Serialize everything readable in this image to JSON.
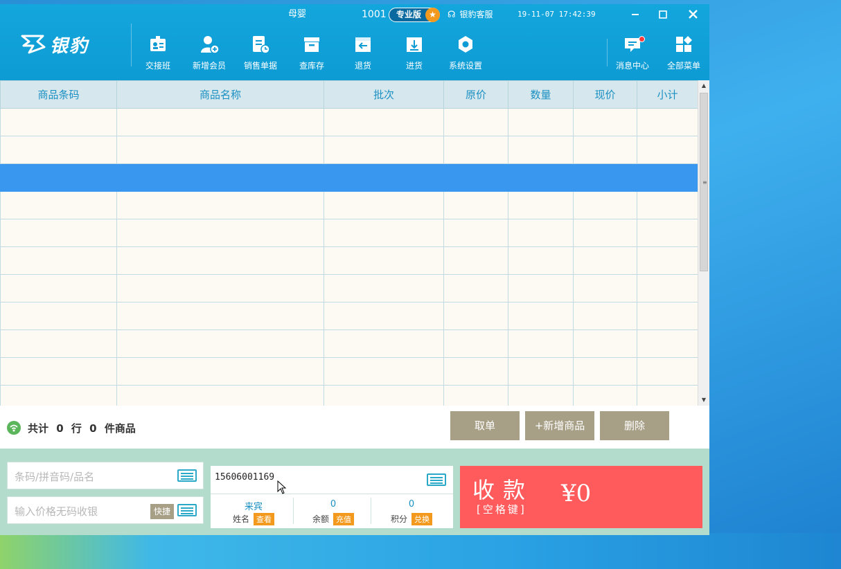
{
  "header": {
    "store_name": "母婴",
    "account_no": "1001",
    "edition": "专业版",
    "service_label": "银豹客服",
    "datetime": "19-11-07 17:42:39",
    "logo_text": "银豹",
    "nav": [
      {
        "label": "交接班",
        "icon": "handover-icon"
      },
      {
        "label": "新增会员",
        "icon": "add-member-icon"
      },
      {
        "label": "销售单据",
        "icon": "sales-doc-icon"
      },
      {
        "label": "查库存",
        "icon": "inventory-icon"
      },
      {
        "label": "退货",
        "icon": "return-icon"
      },
      {
        "label": "进货",
        "icon": "purchase-icon"
      },
      {
        "label": "系统设置",
        "icon": "settings-icon"
      }
    ],
    "right_nav": [
      {
        "label": "消息中心",
        "icon": "message-icon"
      },
      {
        "label": "全部菜单",
        "icon": "all-menu-icon"
      }
    ]
  },
  "table": {
    "columns": [
      "商品条码",
      "商品名称",
      "批次",
      "原价",
      "数量",
      "现价",
      "小计"
    ],
    "selected_row": 2
  },
  "summary": {
    "prefix": "共计",
    "rows": "0",
    "rows_unit": "行",
    "items": "0",
    "items_unit": "件商品"
  },
  "actions": {
    "cancel_order": "取单",
    "add_product": "+新增商品",
    "delete": "删除"
  },
  "inputs": {
    "barcode_placeholder": "条码/拼音码/品名",
    "price_placeholder": "输入价格无码收银",
    "quick_label": "快捷"
  },
  "member": {
    "phone": "15606001169",
    "name_value": "来宾",
    "name_label": "姓名",
    "name_action": "查看",
    "balance_value": "0",
    "balance_label": "余额",
    "balance_action": "充值",
    "points_value": "0",
    "points_label": "积分",
    "points_action": "兑换"
  },
  "pay": {
    "title": "收款",
    "hint": "[空格键]",
    "amount": "¥0"
  },
  "colors": {
    "header": "#0e9bd4",
    "selected_row": "#3a97f0",
    "pay": "#ff5a5c",
    "action_button": "#a89f87",
    "tag": "#f39a1e"
  }
}
